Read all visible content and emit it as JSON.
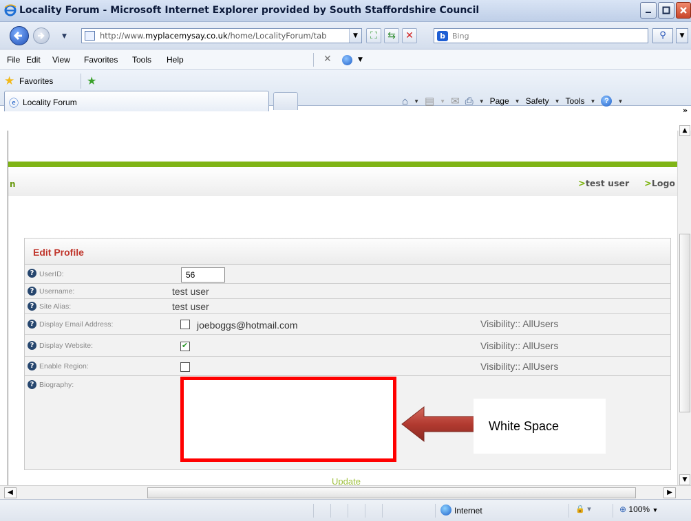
{
  "window": {
    "title": "Locality Forum - Microsoft Internet Explorer provided by South Staffordshire Council"
  },
  "address_bar": {
    "url_prefix": "http://www.",
    "url_domain": "myplacemysay.co.uk",
    "url_path": "/home/LocalityForum/tab",
    "search_placeholder": "Bing"
  },
  "menu": {
    "items": [
      "File",
      "Edit",
      "View",
      "Favorites",
      "Tools",
      "Help"
    ]
  },
  "favorites_bar": {
    "label": "Favorites"
  },
  "tab": {
    "label": "Locality Forum"
  },
  "command_bar": {
    "page": "Page",
    "safety": "Safety",
    "tools": "Tools"
  },
  "site_header": {
    "left_fragment": "n",
    "user_link": "test user",
    "logout_link": "Logo"
  },
  "profile": {
    "title": "Edit Profile",
    "rows": [
      {
        "label": "UserID:",
        "value": "56"
      },
      {
        "label": "Username:",
        "value": "test user"
      },
      {
        "label": "Site Alias:",
        "value": "test user"
      },
      {
        "label": "Display Email Address:",
        "value": "joeboggs@hotmail.com",
        "checked": false,
        "visibility": "Visibility:: AllUsers"
      },
      {
        "label": "Display Website:",
        "checked": true,
        "visibility": "Visibility:: AllUsers"
      },
      {
        "label": "Enable Region:",
        "checked": false,
        "visibility": "Visibility:: AllUsers"
      },
      {
        "label": "Biography:"
      }
    ],
    "update_label": "Update"
  },
  "annotation": {
    "callout_text": "White Space",
    "highlight_color": "#ff0000",
    "arrow_color": "#b23a30"
  },
  "status_bar": {
    "zone": "Internet",
    "zoom": "100%"
  },
  "colors": {
    "accent_green": "#80b516",
    "title_red": "#c0362c"
  }
}
